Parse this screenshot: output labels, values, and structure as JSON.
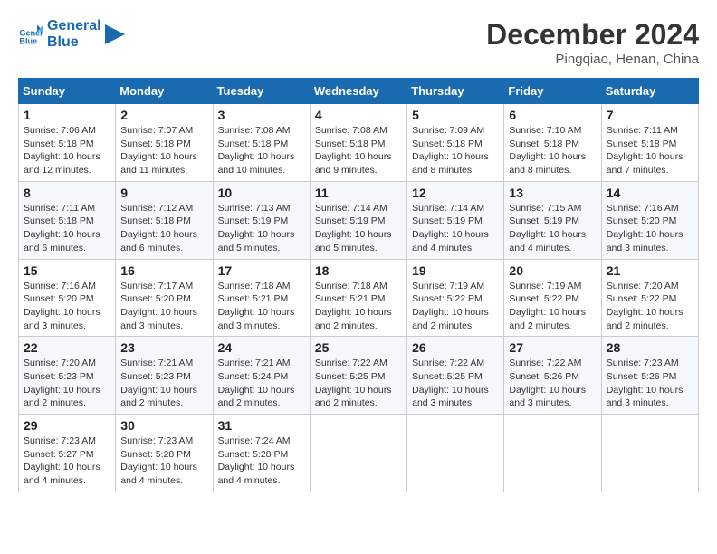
{
  "header": {
    "logo_line1": "General",
    "logo_line2": "Blue",
    "month": "December 2024",
    "location": "Pingqiao, Henan, China"
  },
  "weekdays": [
    "Sunday",
    "Monday",
    "Tuesday",
    "Wednesday",
    "Thursday",
    "Friday",
    "Saturday"
  ],
  "weeks": [
    [
      {
        "day": "1",
        "info": "Sunrise: 7:06 AM\nSunset: 5:18 PM\nDaylight: 10 hours\nand 12 minutes."
      },
      {
        "day": "2",
        "info": "Sunrise: 7:07 AM\nSunset: 5:18 PM\nDaylight: 10 hours\nand 11 minutes."
      },
      {
        "day": "3",
        "info": "Sunrise: 7:08 AM\nSunset: 5:18 PM\nDaylight: 10 hours\nand 10 minutes."
      },
      {
        "day": "4",
        "info": "Sunrise: 7:08 AM\nSunset: 5:18 PM\nDaylight: 10 hours\nand 9 minutes."
      },
      {
        "day": "5",
        "info": "Sunrise: 7:09 AM\nSunset: 5:18 PM\nDaylight: 10 hours\nand 8 minutes."
      },
      {
        "day": "6",
        "info": "Sunrise: 7:10 AM\nSunset: 5:18 PM\nDaylight: 10 hours\nand 8 minutes."
      },
      {
        "day": "7",
        "info": "Sunrise: 7:11 AM\nSunset: 5:18 PM\nDaylight: 10 hours\nand 7 minutes."
      }
    ],
    [
      {
        "day": "8",
        "info": "Sunrise: 7:11 AM\nSunset: 5:18 PM\nDaylight: 10 hours\nand 6 minutes."
      },
      {
        "day": "9",
        "info": "Sunrise: 7:12 AM\nSunset: 5:18 PM\nDaylight: 10 hours\nand 6 minutes."
      },
      {
        "day": "10",
        "info": "Sunrise: 7:13 AM\nSunset: 5:19 PM\nDaylight: 10 hours\nand 5 minutes."
      },
      {
        "day": "11",
        "info": "Sunrise: 7:14 AM\nSunset: 5:19 PM\nDaylight: 10 hours\nand 5 minutes."
      },
      {
        "day": "12",
        "info": "Sunrise: 7:14 AM\nSunset: 5:19 PM\nDaylight: 10 hours\nand 4 minutes."
      },
      {
        "day": "13",
        "info": "Sunrise: 7:15 AM\nSunset: 5:19 PM\nDaylight: 10 hours\nand 4 minutes."
      },
      {
        "day": "14",
        "info": "Sunrise: 7:16 AM\nSunset: 5:20 PM\nDaylight: 10 hours\nand 3 minutes."
      }
    ],
    [
      {
        "day": "15",
        "info": "Sunrise: 7:16 AM\nSunset: 5:20 PM\nDaylight: 10 hours\nand 3 minutes."
      },
      {
        "day": "16",
        "info": "Sunrise: 7:17 AM\nSunset: 5:20 PM\nDaylight: 10 hours\nand 3 minutes."
      },
      {
        "day": "17",
        "info": "Sunrise: 7:18 AM\nSunset: 5:21 PM\nDaylight: 10 hours\nand 3 minutes."
      },
      {
        "day": "18",
        "info": "Sunrise: 7:18 AM\nSunset: 5:21 PM\nDaylight: 10 hours\nand 2 minutes."
      },
      {
        "day": "19",
        "info": "Sunrise: 7:19 AM\nSunset: 5:22 PM\nDaylight: 10 hours\nand 2 minutes."
      },
      {
        "day": "20",
        "info": "Sunrise: 7:19 AM\nSunset: 5:22 PM\nDaylight: 10 hours\nand 2 minutes."
      },
      {
        "day": "21",
        "info": "Sunrise: 7:20 AM\nSunset: 5:22 PM\nDaylight: 10 hours\nand 2 minutes."
      }
    ],
    [
      {
        "day": "22",
        "info": "Sunrise: 7:20 AM\nSunset: 5:23 PM\nDaylight: 10 hours\nand 2 minutes."
      },
      {
        "day": "23",
        "info": "Sunrise: 7:21 AM\nSunset: 5:23 PM\nDaylight: 10 hours\nand 2 minutes."
      },
      {
        "day": "24",
        "info": "Sunrise: 7:21 AM\nSunset: 5:24 PM\nDaylight: 10 hours\nand 2 minutes."
      },
      {
        "day": "25",
        "info": "Sunrise: 7:22 AM\nSunset: 5:25 PM\nDaylight: 10 hours\nand 2 minutes."
      },
      {
        "day": "26",
        "info": "Sunrise: 7:22 AM\nSunset: 5:25 PM\nDaylight: 10 hours\nand 3 minutes."
      },
      {
        "day": "27",
        "info": "Sunrise: 7:22 AM\nSunset: 5:26 PM\nDaylight: 10 hours\nand 3 minutes."
      },
      {
        "day": "28",
        "info": "Sunrise: 7:23 AM\nSunset: 5:26 PM\nDaylight: 10 hours\nand 3 minutes."
      }
    ],
    [
      {
        "day": "29",
        "info": "Sunrise: 7:23 AM\nSunset: 5:27 PM\nDaylight: 10 hours\nand 4 minutes."
      },
      {
        "day": "30",
        "info": "Sunrise: 7:23 AM\nSunset: 5:28 PM\nDaylight: 10 hours\nand 4 minutes."
      },
      {
        "day": "31",
        "info": "Sunrise: 7:24 AM\nSunset: 5:28 PM\nDaylight: 10 hours\nand 4 minutes."
      },
      null,
      null,
      null,
      null
    ]
  ]
}
